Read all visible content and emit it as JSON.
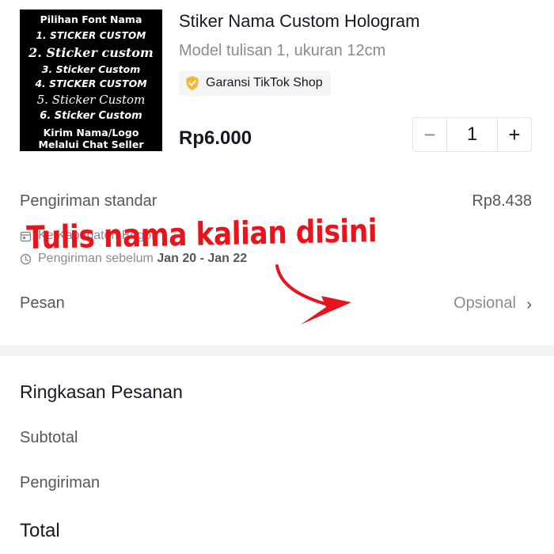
{
  "product": {
    "image_lines": [
      "Pilihan Font Nama",
      "1. STICKER CUSTOM",
      "2. Sticker custom",
      "3. Sticker Custom",
      "4. STICKER CUSTOM",
      "5. Sticker Custom",
      "6. Sticker Custom",
      "Kirim Nama/Logo",
      "Melalui Chat Seller"
    ],
    "title": "Stiker Nama Custom Hologram",
    "variant": "Model tulisan 1, ukuran 12cm",
    "badge": {
      "icon": "shield-check-icon",
      "label": "Garansi TikTok Shop",
      "color": "#f6b638"
    },
    "price": "Rp6.000",
    "quantity": {
      "minus": "−",
      "value": "1",
      "plus": "+"
    }
  },
  "shipping": {
    "label": "Pengiriman standar",
    "cost": "Rp8.438",
    "destination_icon": "calendar-box-icon",
    "destination": "Ke Kabupaten Bogor",
    "eta_icon": "clock-icon",
    "eta_prefix": "Pengiriman sebelum",
    "eta_dates": "Jan 20 - Jan 22"
  },
  "message": {
    "label": "Pesan",
    "value": "Opsional",
    "chevron": "›"
  },
  "summary": {
    "title": "Ringkasan Pesanan",
    "subtotal_label": "Subtotal",
    "shipping_label": "Pengiriman",
    "total_label": "Total"
  },
  "annotation": {
    "text": "Tulis nama kalian disini",
    "color": "#e8131b"
  }
}
